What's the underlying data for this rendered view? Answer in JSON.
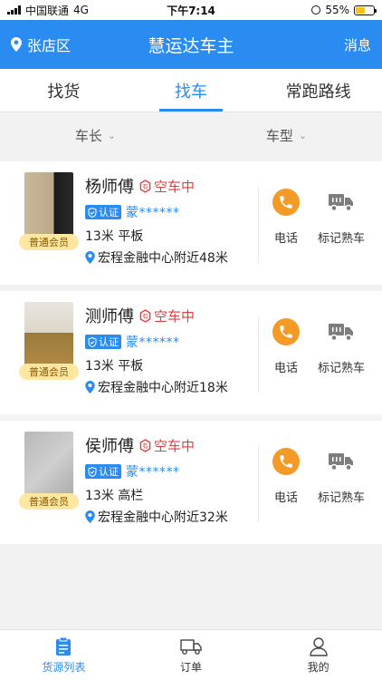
{
  "status_bar": {
    "carrier": "中国联通",
    "network": "4G",
    "time": "下午7:14",
    "battery": "55%",
    "battery_level": 0.55
  },
  "header": {
    "location": "张店区",
    "title": "慧运达车主",
    "messages": "消息"
  },
  "tabs": [
    {
      "label": "找货"
    },
    {
      "label": "找车",
      "active": true
    },
    {
      "label": "常跑路线"
    }
  ],
  "filters": [
    {
      "label": "车长"
    },
    {
      "label": "车型"
    }
  ],
  "drivers": [
    {
      "name": "杨师傅",
      "status": "空车中",
      "cert": "认证",
      "plate": "蒙******",
      "vehicle": "13米 平板",
      "location": "宏程金融中心附近48米",
      "member": "普通会员",
      "call": "电话",
      "mark": "标记熟车"
    },
    {
      "name": "测师傅",
      "status": "空车中",
      "cert": "认证",
      "plate": "蒙******",
      "vehicle": "13米 平板",
      "location": "宏程金融中心附近18米",
      "member": "普通会员",
      "call": "电话",
      "mark": "标记熟车"
    },
    {
      "name": "侯师傅",
      "status": "空车中",
      "cert": "认证",
      "plate": "蒙******",
      "vehicle": "13米 高栏",
      "location": "宏程金融中心附近32米",
      "member": "普通会员",
      "call": "电话",
      "mark": "标记熟车"
    }
  ],
  "bottom_nav": [
    {
      "label": "货源列表",
      "active": true
    },
    {
      "label": "订单"
    },
    {
      "label": "我的"
    }
  ],
  "colors": {
    "brand": "#2a8cf0",
    "status_red": "#e43d3d",
    "phone_orange": "#f39a27",
    "member_bg": "#fde7a2"
  },
  "icons": {
    "location": "location-pin-icon",
    "chevron": "chevron-down-icon",
    "status": "hexagon-status-icon",
    "cert": "shield-check-icon",
    "pin": "map-pin-icon",
    "phone": "phone-icon",
    "truck": "truck-icon",
    "nav_list": "clipboard-list-icon",
    "nav_order": "delivery-truck-icon",
    "nav_me": "user-icon"
  }
}
